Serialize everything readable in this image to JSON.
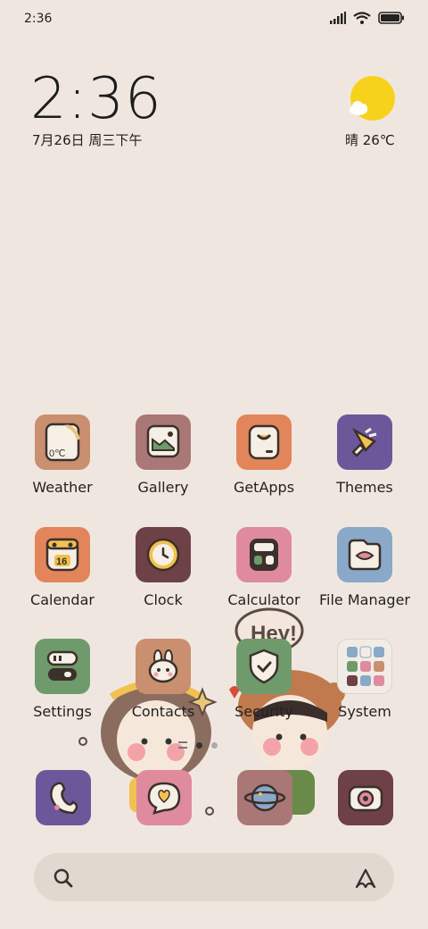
{
  "status_bar": {
    "time": "2:36"
  },
  "clock_widget": {
    "time": "2:36",
    "date": "7月26日 周三下午"
  },
  "weather_widget": {
    "text": "晴 26℃",
    "icon": "sun-cloud-icon"
  },
  "apps": [
    {
      "label": "Weather",
      "icon": "weather-app-icon",
      "color": "#c98f6e",
      "icon_text": "0℃"
    },
    {
      "label": "Gallery",
      "icon": "gallery-app-icon",
      "color": "#a97876"
    },
    {
      "label": "GetApps",
      "icon": "getapps-app-icon",
      "color": "#e3855a"
    },
    {
      "label": "Themes",
      "icon": "themes-app-icon",
      "color": "#6d579b"
    },
    {
      "label": "Calendar",
      "icon": "calendar-app-icon",
      "color": "#e3855a",
      "icon_text": "16"
    },
    {
      "label": "Clock",
      "icon": "clock-app-icon",
      "color": "#6d4145"
    },
    {
      "label": "Calculator",
      "icon": "calculator-app-icon",
      "color": "#e08a9d"
    },
    {
      "label": "File Manager",
      "icon": "file-manager-app-icon",
      "color": "#8aa8c8"
    },
    {
      "label": "Settings",
      "icon": "settings-app-icon",
      "color": "#6f9a6c"
    },
    {
      "label": "Contacts",
      "icon": "contacts-app-icon",
      "color": "#c98f6e"
    },
    {
      "label": "Security",
      "icon": "security-app-icon",
      "color": "#6f9a6c"
    },
    {
      "label": "System",
      "icon": "system-folder-icon",
      "color": "#f2ece6"
    }
  ],
  "dock": [
    {
      "icon": "phone-app-icon",
      "color": "#6d579b"
    },
    {
      "icon": "messages-app-icon",
      "color": "#e08a9d"
    },
    {
      "icon": "browser-app-icon",
      "color": "#a97876"
    },
    {
      "icon": "camera-app-icon",
      "color": "#6d4145"
    }
  ],
  "wallpaper": {
    "speech_bubble": "Hey!"
  },
  "page_indicator": {
    "pages": 2,
    "current": 1
  }
}
